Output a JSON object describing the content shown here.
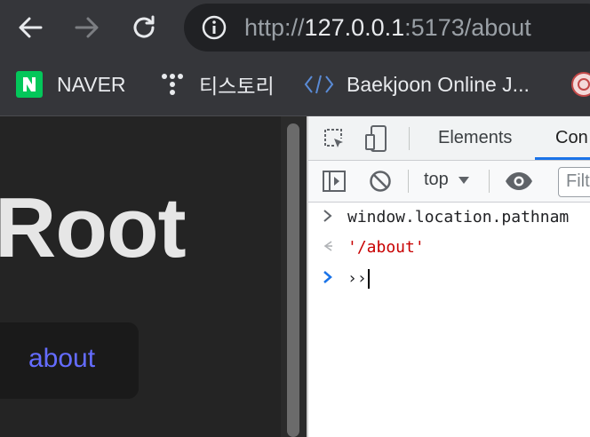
{
  "browser": {
    "url_scheme": "http://",
    "url_host": "127.0.0.1",
    "url_rest": ":5173/about"
  },
  "bookmarks": [
    {
      "label": "NAVER",
      "icon": "naver-icon"
    },
    {
      "label": "티스토리",
      "icon": "tistory-icon"
    },
    {
      "label": "Baekjoon Online J...",
      "icon": "code-icon"
    }
  ],
  "page": {
    "title": "Root",
    "link_label": "about"
  },
  "devtools": {
    "tabs": [
      "Elements",
      "Con"
    ],
    "context": "top",
    "filter_placeholder": "Filt",
    "console": [
      {
        "prefix": ">",
        "text": "window.location.pathnam"
      },
      {
        "prefix": "<",
        "text": "'/about'"
      },
      {
        "prefix": ">",
        "text": "››"
      }
    ]
  },
  "colors": {
    "link": "#646cff",
    "console_string": "#c80000",
    "active_tab": "#1a73e8"
  }
}
